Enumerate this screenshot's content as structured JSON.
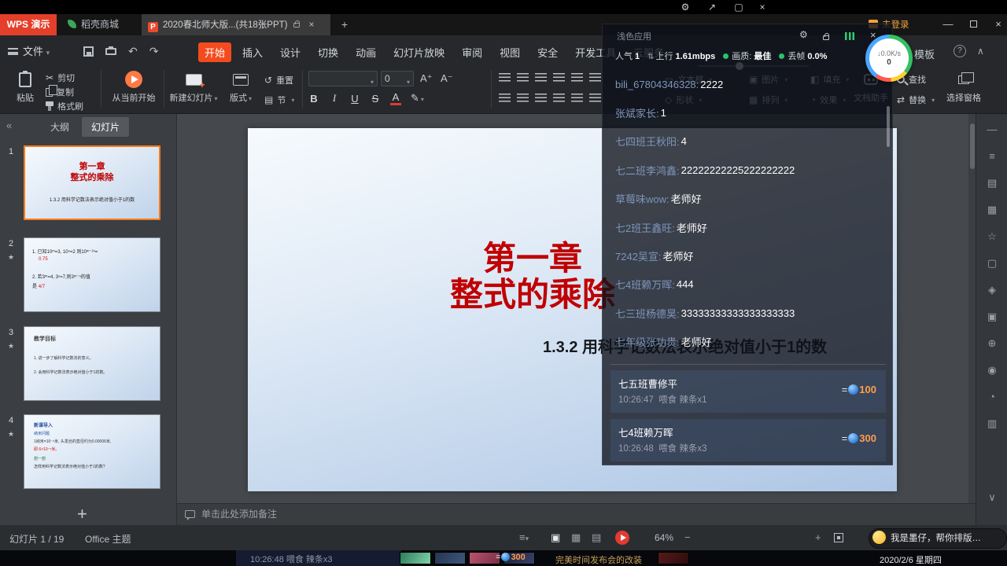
{
  "colors": {
    "accent_orange": "#f44b1e",
    "slide_title_red": "#c00000",
    "live_green": "#27c46a",
    "amount_orange": "#ff9d4d",
    "coin_blue": "#2f7fd6"
  },
  "titlebar": {
    "app_tab": "WPS 演示",
    "store_tab": "稻壳商城",
    "doc_tab": "2020春北师大版...(共18张PPT)",
    "new_tab": "+",
    "login": "未登录"
  },
  "menubar": {
    "file": "文件",
    "items": [
      "开始",
      "插入",
      "设计",
      "切换",
      "动画",
      "幻灯片放映",
      "审阅",
      "视图",
      "安全",
      "开发工具",
      "云服务"
    ],
    "template": "模板",
    "help": "?"
  },
  "toolbar": {
    "paste": "粘贴",
    "cut": "剪切",
    "copy": "复制",
    "format_painter": "格式刷",
    "from_current": "从当前开始",
    "new_slide": "新建幻灯片",
    "layout": "版式",
    "reset": "重置",
    "section": "节",
    "font_size": "0",
    "grow_font": "A⁺",
    "shrink_font": "A⁻",
    "bold": "B",
    "italic": "I",
    "underline": "U",
    "strike": "S",
    "font_color": "A",
    "text_box": "文本框",
    "shape": "形状",
    "picture": "图片",
    "fill": "填充",
    "arrange": "排列",
    "effect": "效果",
    "doc_helper": "文档助手",
    "find": "查找",
    "replace": "替换",
    "select_pane": "选择窗格"
  },
  "panel": {
    "outline_tab": "大纲",
    "slides_tab": "幻灯片",
    "add_slide": "+",
    "thumbs": [
      {
        "num": "1",
        "line1": "第一章",
        "line2": "整式的乘除",
        "line3": "1.3.2 用科学记数法表示绝对值小于1的数"
      },
      {
        "num": "2",
        "q1": "1. 已知10ᵐ=3, 10ⁿ=2 则10ᵐ⁻²ⁿ=",
        "a1": "0.75",
        "q2": "2. 若3ᵐ=4, 3ⁿ=7,则3ᵐ⁻ⁿ的值",
        "a2_prefix": "是",
        "a2": "4/7"
      },
      {
        "num": "3",
        "title": "教学目标",
        "l1": "1. 进一步了解科学记数法的意义。",
        "l2": "2. 会用科学记数法表示绝对值小于1的数。"
      },
      {
        "num": "4",
        "title": "新课导入",
        "l1": "纳米问题",
        "l2": "1纳米=10⁻⁹米, 头发丝的直径约为0.00006米,",
        "l3": "即 6×10⁻⁵米。",
        "l4": "想一想",
        "l5": "怎样用科学记数法表示绝对值小于1的数?"
      }
    ]
  },
  "slide": {
    "title1": "第一章",
    "title2": "整式的乘除",
    "subtitle": "1.3.2 用科学记数法表示绝对值小于1的数"
  },
  "notes": {
    "placeholder": "单击此处添加备注"
  },
  "statusbar": {
    "counter": "幻灯片 1 / 19",
    "theme": "Office 主题",
    "zoom": "64%"
  },
  "assistant": {
    "text": "我是墨仔，帮你排版…"
  },
  "overlay": {
    "header": "浅色应用",
    "stats": {
      "pop_label": "人气",
      "pop_value": "1",
      "up_label": "上行",
      "up_value": "1.61mbps",
      "quality_label": "画质:",
      "quality_value": "最佳",
      "drop_label": "丢帧",
      "drop_value": "0.0%"
    },
    "messages": [
      {
        "user": "bili_67804346328",
        "text": "2222"
      },
      {
        "user": "张斌家长",
        "text": "1"
      },
      {
        "user": "七四班王秋阳",
        "text": "4"
      },
      {
        "user": "七二班李鸿鑫",
        "text": "22222222225222222222"
      },
      {
        "user": "草莓味wow",
        "text": "老师好"
      },
      {
        "user": "七2班王鑫旺",
        "text": "老师好"
      },
      {
        "user": "7242吴宣",
        "text": "老师好"
      },
      {
        "user": "七4班赖万晖",
        "text": "444"
      },
      {
        "user": "七三班杨德昊",
        "text": "33333333333333333333"
      },
      {
        "user": "七年级张功贵",
        "text": "老师好"
      }
    ],
    "gifts": [
      {
        "user": "七五班曹修平",
        "time": "10:26:47",
        "action": "喂食 辣条x1",
        "eq": "=",
        "amount": "100"
      },
      {
        "user": "七4班赖万晖",
        "time": "10:26:48",
        "action": "喂食 辣条x3",
        "eq": "=",
        "amount": "300"
      }
    ]
  },
  "ball": {
    "speed": "0.0K/s",
    "count": "0"
  },
  "taskbar": {
    "gift_line": "10:26:48 喂食 辣条x3",
    "gift_eq": "=",
    "gift_amount": "300",
    "marquee": "完美时间发布会的改装",
    "date": "2020/2/6 星期四"
  }
}
